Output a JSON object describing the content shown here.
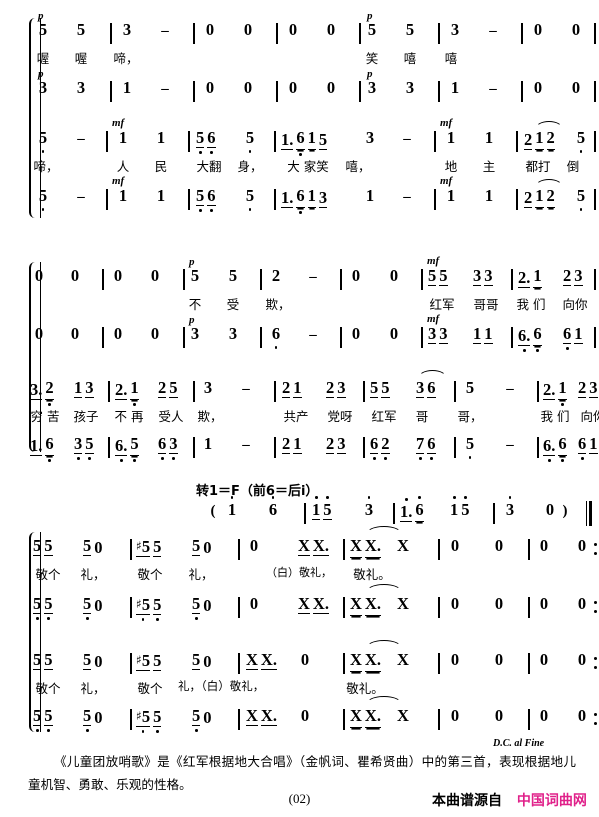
{
  "document": {
    "kind": "jianpu-choral-score",
    "page_number": "(02)"
  },
  "systems": [
    {
      "id": "system-1",
      "staves": [
        {
          "voice": "soprano",
          "dynamics": [
            {
              "mark": "p",
              "at": 0
            },
            {
              "mark": "p",
              "at": 8
            }
          ],
          "notes": [
            "5",
            "5",
            "3",
            "-",
            "0",
            "0",
            "0",
            "0",
            "5",
            "5",
            "3",
            "-",
            "0",
            "0"
          ],
          "lyrics": [
            "喔",
            "喔",
            "啼，",
            "",
            "",
            "",
            "",
            "",
            "笑",
            "嘻",
            "嘻",
            "",
            "",
            ""
          ]
        },
        {
          "voice": "alto",
          "dynamics": [
            {
              "mark": "p",
              "at": 0
            },
            {
              "mark": "p",
              "at": 8
            }
          ],
          "notes": [
            "3",
            "3",
            "1",
            "-",
            "0",
            "0",
            "0",
            "0",
            "3",
            "3",
            "1",
            "-",
            "0",
            "0"
          ],
          "lyrics": []
        },
        {
          "voice": "tenor",
          "dynamics": [
            {
              "mark": "mf",
              "at": 2
            },
            {
              "mark": "mf",
              "at": 10
            }
          ],
          "notes": [
            "5",
            "-",
            "1",
            "1",
            "5 6",
            "5",
            "1. 6",
            "1 5",
            "3",
            "-",
            "1",
            "1",
            "2 12",
            "5"
          ],
          "lyrics": [
            "啼，",
            "",
            "人",
            "民",
            "大翻",
            "身，",
            "大 家笑",
            "嘻，",
            "",
            "",
            "地",
            "主",
            "都打",
            "倒"
          ]
        },
        {
          "voice": "bass",
          "dynamics": [
            {
              "mark": "mf",
              "at": 2
            },
            {
              "mark": "mf",
              "at": 10
            }
          ],
          "notes": [
            "5",
            "-",
            "1",
            "1",
            "5 6",
            "5",
            "1. 6",
            "1 3",
            "1",
            "-",
            "1",
            "1",
            "2 12",
            "5"
          ],
          "lyrics": []
        }
      ]
    },
    {
      "id": "system-2",
      "staves": [
        {
          "voice": "soprano",
          "dynamics": [
            {
              "mark": "p",
              "at": 4
            },
            {
              "mark": "mf",
              "at": 10
            }
          ],
          "notes": [
            "0",
            "0",
            "0",
            "0",
            "5",
            "5",
            "2",
            "-",
            "0",
            "0",
            "5 5",
            "3 3",
            "2. 1",
            "2 3"
          ],
          "lyrics": [
            "",
            "",
            "",
            "",
            "不",
            "受",
            "欺，",
            "",
            "",
            "",
            "红军",
            "哥哥",
            "我 们",
            "向你"
          ]
        },
        {
          "voice": "alto",
          "dynamics": [
            {
              "mark": "p",
              "at": 4
            },
            {
              "mark": "mf",
              "at": 10
            }
          ],
          "notes": [
            "0",
            "0",
            "0",
            "0",
            "3",
            "3",
            "6",
            "-",
            "0",
            "0",
            "3 3",
            "1 1",
            "6. 6",
            "6 1"
          ],
          "lyrics": []
        },
        {
          "voice": "tenor",
          "dynamics": [],
          "notes": [
            "3. 2",
            "1 3",
            "2. 1",
            "2 5",
            "3",
            "-",
            "2 1",
            "2 3",
            "5 5",
            "3 6",
            "5",
            "-",
            "2. 1",
            "2 3"
          ],
          "lyrics": [
            "穷 苦",
            "孩子",
            "不 再",
            "受人",
            "欺，",
            "",
            "共产",
            "党呀",
            "红军",
            "哥",
            "哥，",
            "",
            "我 们",
            "向你"
          ]
        },
        {
          "voice": "bass",
          "dynamics": [],
          "notes": [
            "1. 6",
            "3 5",
            "6. 5",
            "6 3",
            "1",
            "-",
            "2 1",
            "2 3",
            "6 2",
            "7 6",
            "5",
            "-",
            "6. 6",
            "6 1"
          ],
          "lyrics": []
        }
      ]
    },
    {
      "id": "modulation",
      "text": "转1＝F（前6＝后i）",
      "cue_notes": [
        "( i",
        "6",
        "i 5",
        "3",
        "1. 6",
        "i 5",
        "3",
        "0 )"
      ]
    },
    {
      "id": "system-3",
      "staves": [
        {
          "voice": "soprano",
          "notes": [
            "5 5",
            "5 0",
            "♯5 5",
            "5 0",
            "0",
            "X X.",
            "X X.  X",
            "0",
            "0",
            "0",
            "0"
          ],
          "lyrics": [
            "敬个",
            "礼，",
            "敬个",
            "礼，",
            "",
            "（白）敬礼，",
            "敬礼。",
            "",
            "",
            "",
            ""
          ]
        },
        {
          "voice": "alto",
          "notes": [
            "5 5",
            "5 0",
            "♯5 5",
            "5 0",
            "0",
            "X X.",
            "X X.  X",
            "0",
            "0",
            "0",
            "0"
          ],
          "lyrics": []
        },
        {
          "voice": "tenor",
          "notes": [
            "5 5",
            "5 0",
            "♯5 5",
            "5 0",
            "X X.",
            "0",
            "X X.  X",
            "0",
            "0",
            "0",
            "0"
          ],
          "lyrics": [
            "敬个",
            "礼，",
            "敬个",
            "礼，（白）敬礼，",
            "",
            "",
            "敬礼。",
            "",
            "",
            "",
            ""
          ]
        },
        {
          "voice": "bass",
          "notes": [
            "5 5",
            "5 0",
            "♯5 5",
            "5 0",
            "X X.",
            "0",
            "X X.  X",
            "0",
            "0",
            "0",
            "0"
          ],
          "lyrics": []
        }
      ],
      "tempo_mark": "D.C. al Fine"
    }
  ],
  "footer": {
    "note_paragraph": "《儿童团放哨歌》是《红军根据地大合唱》（金帆词、瞿希贤曲）中的第三首，表现根据地儿童机智、勇敢、乐观的性格。",
    "page_number": "(02)",
    "watermark_prefix": "本曲谱源自",
    "watermark_brand": "中国词曲网",
    "watermark_brand_color": "#e0218a"
  }
}
